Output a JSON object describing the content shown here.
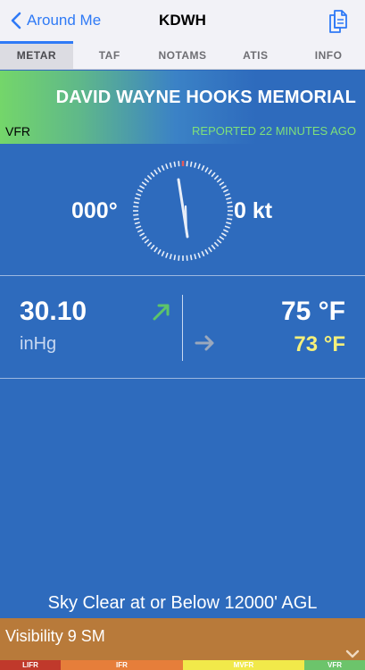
{
  "nav": {
    "back_label": "Around Me",
    "title": "KDWH"
  },
  "tabs": [
    {
      "label": "METAR",
      "active": true
    },
    {
      "label": "TAF",
      "active": false
    },
    {
      "label": "NOTAMS",
      "active": false
    },
    {
      "label": "ATIS",
      "active": false
    },
    {
      "label": "INFO",
      "active": false
    }
  ],
  "station": {
    "name": "DAVID WAYNE HOOKS MEMORIAL",
    "flight_category": "VFR",
    "reported": "REPORTED 22 MINUTES AGO"
  },
  "wind": {
    "direction": "000°",
    "speed": "0 kt"
  },
  "altimeter": {
    "value": "30.10",
    "unit": "inHg",
    "trend": "rising"
  },
  "temperature": {
    "temp": "75 °F",
    "dewpoint": "73 °F",
    "trend": "steady"
  },
  "sky": "Sky Clear at or Below 12000' AGL",
  "visibility": "Visibility 9 SM",
  "category_scale": [
    "LIFR",
    "IFR",
    "MVFR",
    "VFR"
  ],
  "colors": {
    "accent": "#2f7af6",
    "background": "#2e6bbd",
    "vfr_green": "#74d66a",
    "dewpoint_yellow": "#f5f07a",
    "visibility_bar": "#b87a3a",
    "lifr": "#c0392b",
    "ifr": "#e67e3a",
    "mvfr": "#f1e94a",
    "vfr": "#6cc46b"
  }
}
